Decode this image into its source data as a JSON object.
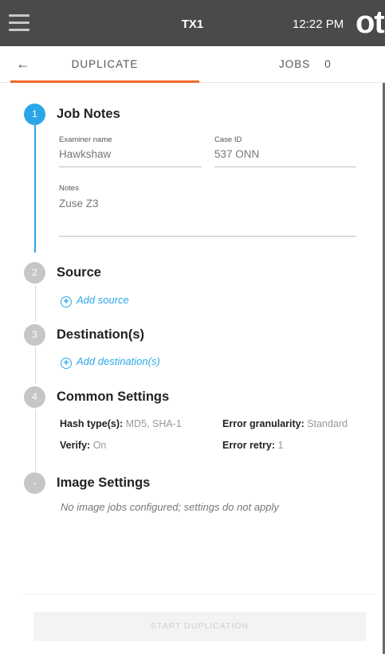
{
  "header": {
    "menu_icon": "hamburger-icon",
    "device_name": "TX1",
    "time": "12:22 PM",
    "logo_text": "ot"
  },
  "tabs": {
    "back_icon": "←",
    "duplicate_label": "DUPLICATE",
    "jobs_label": "JOBS",
    "jobs_count": "0",
    "active_color": "#f26a2a"
  },
  "steps": {
    "job_notes": {
      "number": "1",
      "title": "Job Notes",
      "examiner_label": "Examiner name",
      "examiner_value": "Hawkshaw",
      "case_label": "Case ID",
      "case_value": "537 ONN",
      "notes_label": "Notes",
      "notes_value": "Zuse Z3"
    },
    "source": {
      "number": "2",
      "title": "Source",
      "add_label": "Add source"
    },
    "destination": {
      "number": "3",
      "title": "Destination(s)",
      "add_label": "Add destination(s)"
    },
    "common": {
      "number": "4",
      "title": "Common Settings",
      "hash_label": "Hash type(s):",
      "hash_value": "MD5, SHA-1",
      "granularity_label": "Error granularity:",
      "granularity_value": "Standard",
      "verify_label": "Verify:",
      "verify_value": "On",
      "retry_label": "Error retry:",
      "retry_value": "1"
    },
    "image": {
      "number": "-",
      "title": "Image Settings",
      "note": "No image jobs configured; settings do not apply"
    }
  },
  "footer": {
    "start_label": "START DUPLICATION"
  },
  "colors": {
    "accent_blue": "#2ba7e8",
    "topbar": "#4a4a4a",
    "inactive_step": "#c6c6c6"
  }
}
